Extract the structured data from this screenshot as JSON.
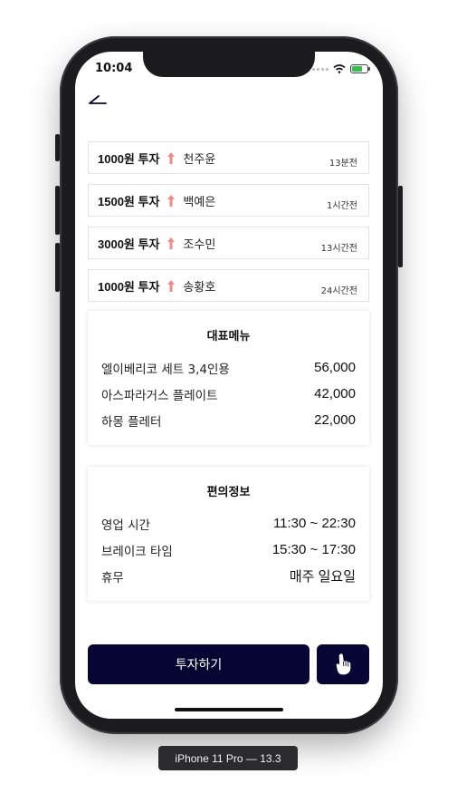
{
  "status_bar": {
    "time": "10:04"
  },
  "investments": [
    {
      "amount": "1000원 투자",
      "name": "천주윤",
      "time": "13분전"
    },
    {
      "amount": "1500원 투자",
      "name": "백예은",
      "time": "1시간전"
    },
    {
      "amount": "3000원 투자",
      "name": "조수민",
      "time": "13시간전"
    },
    {
      "amount": "1000원 투자",
      "name": "송황호",
      "time": "24시간전"
    }
  ],
  "menu": {
    "title": "대표메뉴",
    "items": [
      {
        "name": "엘이베리코 세트 3,4인용",
        "price": "56,000"
      },
      {
        "name": "아스파라거스 플레이트",
        "price": "42,000"
      },
      {
        "name": "하몽 플레터",
        "price": "22,000"
      }
    ]
  },
  "info": {
    "title": "편의정보",
    "items": [
      {
        "label": "영업 시간",
        "value": "11:30 ~ 22:30"
      },
      {
        "label": "브레이크 타임",
        "value": "15:30 ~ 17:30"
      },
      {
        "label": "휴무",
        "value": "매주 일요일"
      }
    ]
  },
  "actions": {
    "invest_label": "투자하기"
  },
  "device_label": "iPhone 11 Pro — 13.3",
  "colors": {
    "primary": "#070533",
    "arrow": "#f08a86"
  }
}
